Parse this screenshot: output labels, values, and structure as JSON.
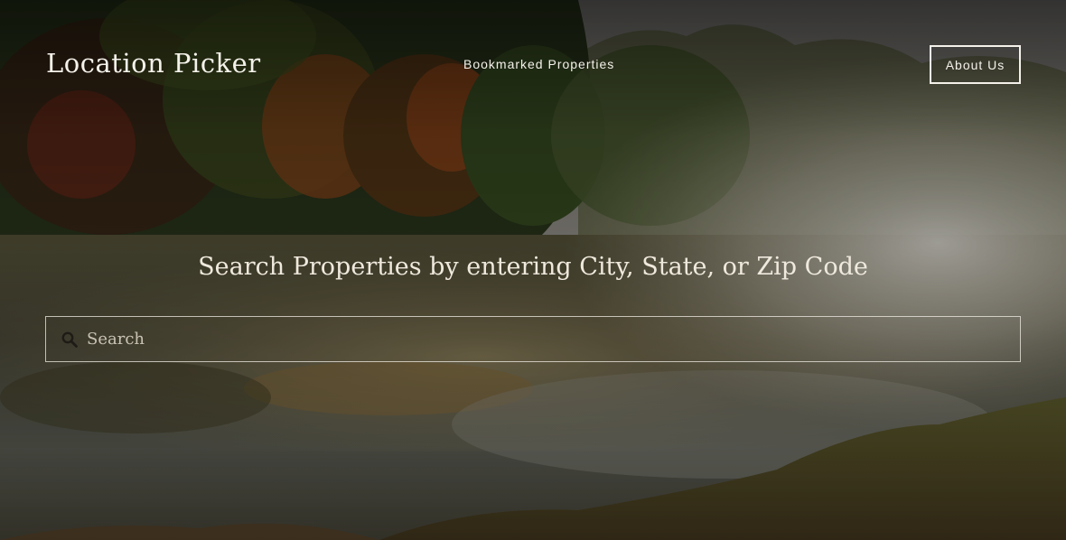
{
  "header": {
    "brand": "Location Picker",
    "nav_bookmarked": "Bookmarked Properties",
    "about_button": "About Us"
  },
  "hero": {
    "headline": "Search Properties by entering City, State, or Zip Code",
    "background": "misty pond at sunrise with autumn trees"
  },
  "search": {
    "placeholder": "Search",
    "value": "",
    "icon": "search-icon"
  },
  "colors": {
    "text": "#f4f1ea",
    "overlay": "rgba(0,0,0,0.18)"
  }
}
